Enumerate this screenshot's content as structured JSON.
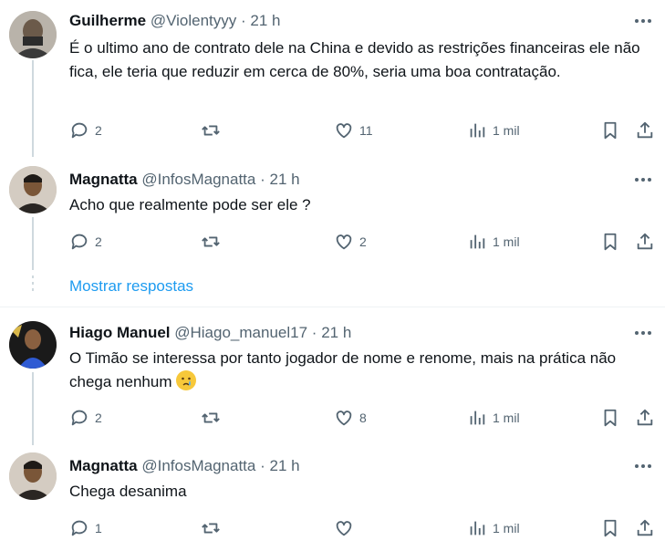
{
  "tweets": [
    {
      "name": "Guilherme",
      "handle": "@Violentyyy",
      "dot": "·",
      "time": "21 h",
      "text": "É o ultimo ano de contrato dele na China e devido as restrições financeiras ele não fica, ele teria que reduzir em cerca de 80%, seria uma boa contratação.",
      "replies": "2",
      "retweets": "",
      "likes": "11",
      "views": "1 mil"
    },
    {
      "name": "Magnatta",
      "handle": "@InfosMagnatta",
      "dot": "·",
      "time": "21 h",
      "text": "Acho que realmente pode ser ele ?",
      "replies": "2",
      "retweets": "",
      "likes": "2",
      "views": "1 mil"
    },
    {
      "name": "Hiago Manuel",
      "handle": "@Hiago_manuel17",
      "dot": "·",
      "time": "21 h",
      "text": "O Timão se interessa por tanto jogador de nome e renome, mais na prática não chega nenhum",
      "emoji": "crying-face",
      "replies": "2",
      "retweets": "",
      "likes": "8",
      "views": "1 mil"
    },
    {
      "name": "Magnatta",
      "handle": "@InfosMagnatta",
      "dot": "·",
      "time": "21 h",
      "text": "Chega desanima",
      "replies": "1",
      "retweets": "",
      "likes": "",
      "views": "1 mil"
    }
  ],
  "show_replies": "Mostrar respostas",
  "colors": {
    "link": "#1d9bf0",
    "muted": "#536471",
    "text": "#0f1419",
    "line": "#cfd9de"
  },
  "icons": [
    "reply-icon",
    "retweet-icon",
    "like-icon",
    "views-icon",
    "bookmark-icon",
    "share-icon",
    "more-icon"
  ]
}
